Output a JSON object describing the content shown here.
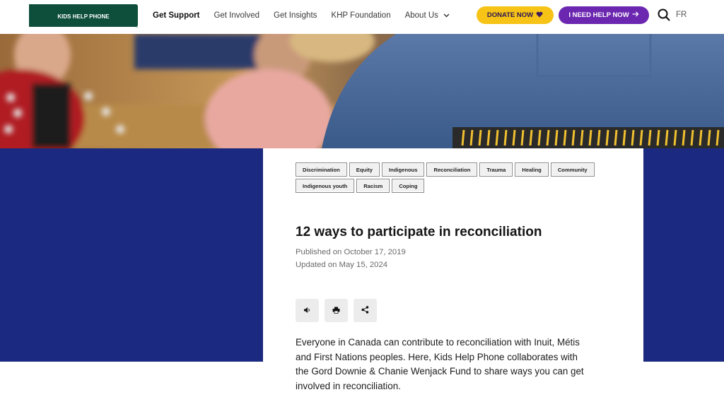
{
  "header": {
    "logo_text": "KIDS HELP PHONE",
    "nav": [
      {
        "label": "Get Support",
        "active": true
      },
      {
        "label": "Get Involved"
      },
      {
        "label": "Get Insights"
      },
      {
        "label": "KHP Foundation"
      },
      {
        "label": "About Us"
      }
    ],
    "donate_label": "DONATE NOW",
    "help_label": "I NEED HELP NOW",
    "lang_label": "FR",
    "icons": {
      "donate": "heart-icon",
      "help": "arrow-right-icon",
      "search": "search-icon",
      "about": "chevron-down-icon"
    }
  },
  "colors": {
    "brand_green": "#0e4f3c",
    "donate_yellow": "#f6c316",
    "help_purple": "#6c27b0",
    "band_navy": "#1b2a80"
  },
  "article": {
    "tags_row1": [
      "Discrimination",
      "Equity",
      "Indigenous",
      "Reconciliation",
      "Trauma",
      "Healing",
      "Community"
    ],
    "tags_row2": [
      "Indigenous youth",
      "Racism",
      "Coping"
    ],
    "title": "12 ways to participate in reconciliation",
    "published": "Published on October 17, 2019",
    "updated": "Updated on May 15, 2024",
    "tools": [
      {
        "name": "speaker-icon"
      },
      {
        "name": "print-icon"
      },
      {
        "name": "share-icon"
      }
    ],
    "intro": "Everyone in Canada can contribute to reconciliation with Inuit, Métis and First Nations peoples. Here, Kids Help Phone collaborates with the Gord Downie & Chanie Wenjack Fund to share ways you can get involved in reconciliation."
  }
}
